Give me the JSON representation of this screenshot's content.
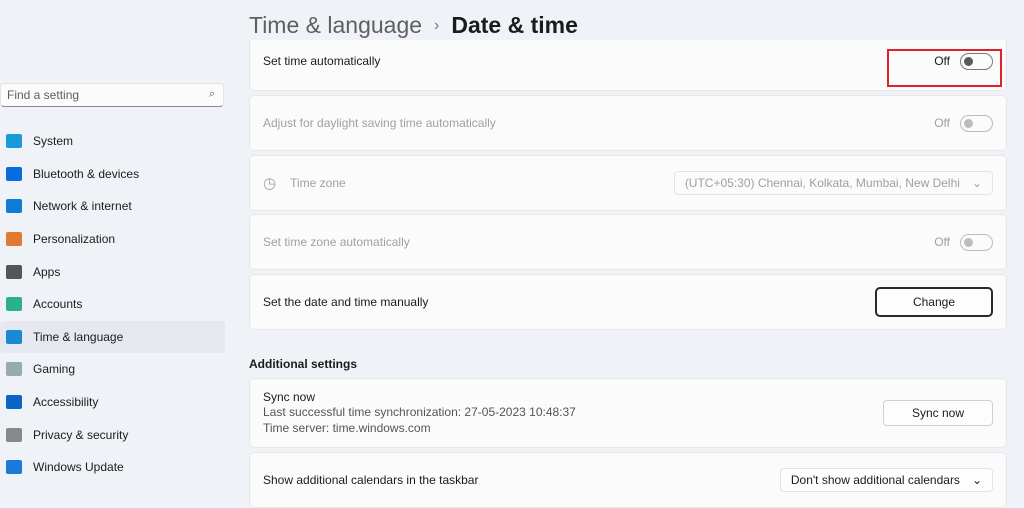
{
  "search": {
    "placeholder": "Find a setting"
  },
  "nav": [
    {
      "label": "System",
      "color": "#1a9ad6"
    },
    {
      "label": "Bluetooth & devices",
      "color": "#0a6cdc"
    },
    {
      "label": "Network & internet",
      "color": "#0f7ad8"
    },
    {
      "label": "Personalization",
      "color": "#e07a30"
    },
    {
      "label": "Apps",
      "color": "#555"
    },
    {
      "label": "Accounts",
      "color": "#2bb08a"
    },
    {
      "label": "Time & language",
      "color": "#1a8ad6"
    },
    {
      "label": "Gaming",
      "color": "#9aa"
    },
    {
      "label": "Accessibility",
      "color": "#0a64c8"
    },
    {
      "label": "Privacy & security",
      "color": "#888"
    },
    {
      "label": "Windows Update",
      "color": "#1a7ad8"
    }
  ],
  "breadcrumb": {
    "parent": "Time & language",
    "sep": "›",
    "current": "Date & time"
  },
  "settings": {
    "auto_time": {
      "label": "Set time automatically",
      "state": "Off"
    },
    "dst": {
      "label": "Adjust for daylight saving time automatically",
      "state": "Off"
    },
    "tz": {
      "label": "Time zone",
      "value": "(UTC+05:30) Chennai, Kolkata, Mumbai, New Delhi"
    },
    "auto_tz": {
      "label": "Set time zone automatically",
      "state": "Off"
    },
    "manual": {
      "label": "Set the date and time manually",
      "button": "Change"
    }
  },
  "additional": {
    "heading": "Additional settings",
    "sync": {
      "title": "Sync now",
      "last": "Last successful time synchronization: 27-05-2023 10:48:37",
      "server": "Time server: time.windows.com",
      "button": "Sync now"
    },
    "calendars": {
      "label": "Show additional calendars in the taskbar",
      "value": "Don't show additional calendars"
    }
  }
}
